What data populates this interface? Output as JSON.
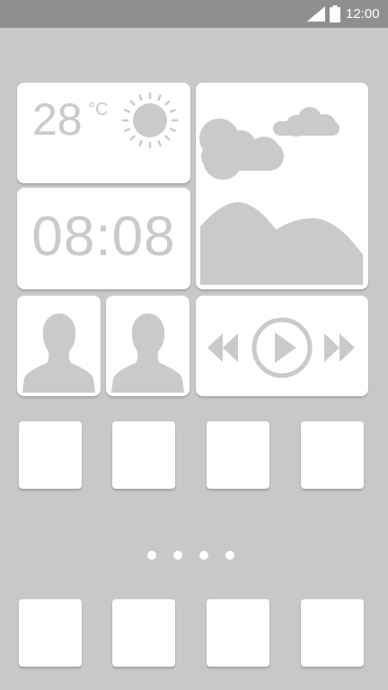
{
  "status_bar": {
    "time": "12:00",
    "signal_icon": "signal-bars-icon",
    "battery_icon": "battery-icon"
  },
  "colors": {
    "background": "#c8c8c8",
    "status_bar": "#8f8f8f",
    "tile": "#ffffff",
    "glyph": "#cacaca"
  },
  "widgets": {
    "weather": {
      "temperature": "28",
      "unit": "°C",
      "icon": "sun-icon"
    },
    "clock": {
      "time": "08:08"
    },
    "photo": {
      "icon": "landscape-photo-icon"
    },
    "contacts": [
      {
        "icon": "person-silhouette-icon"
      },
      {
        "icon": "person-silhouette-icon"
      }
    ],
    "media_player": {
      "rewind_icon": "rewind-icon",
      "play_icon": "play-circle-icon",
      "fast_forward_icon": "fast-forward-icon"
    }
  },
  "home_screen": {
    "app_rows": 2,
    "apps_per_row": 4,
    "page_count": 4
  }
}
